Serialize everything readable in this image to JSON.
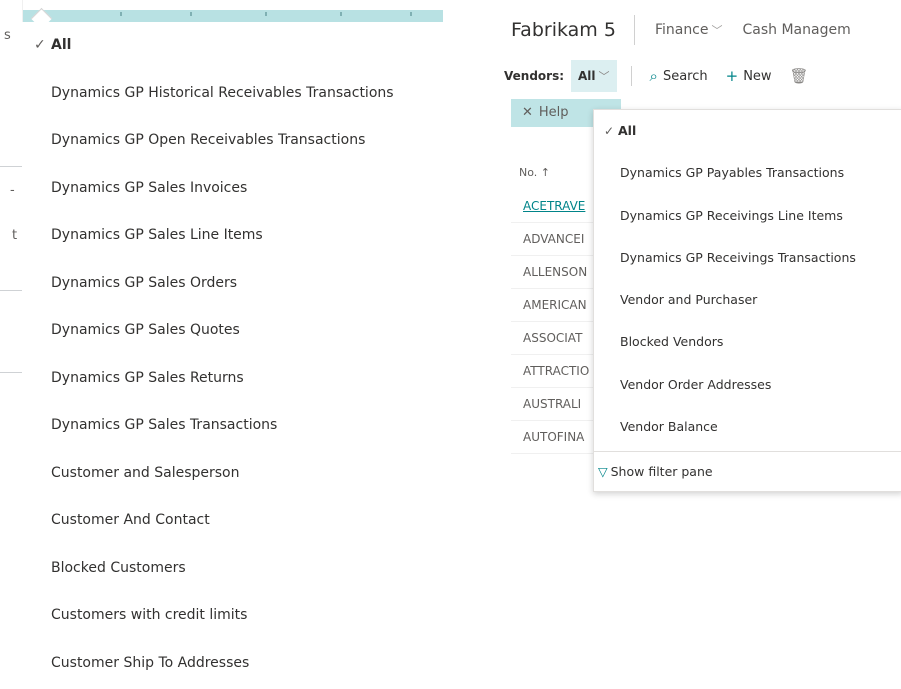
{
  "left_menu": {
    "all_label": "All",
    "items": [
      "Dynamics GP Historical Receivables Transactions",
      "Dynamics GP Open Receivables Transactions",
      "Dynamics GP Sales Invoices",
      "Dynamics GP Sales Line Items",
      "Dynamics GP Sales Orders",
      "Dynamics GP Sales Quotes",
      "Dynamics GP Sales Returns",
      "Dynamics GP Sales Transactions",
      "Customer and Salesperson",
      "Customer And Contact",
      "Blocked Customers",
      "Customers with credit limits",
      "Customer Ship To Addresses"
    ]
  },
  "right": {
    "company": "Fabrikam 5",
    "nav": [
      "Finance",
      "Cash Managem"
    ],
    "vendors_label": "Vendors:",
    "view_value": "All",
    "search_label": "Search",
    "new_label": "New",
    "help_label": "Help",
    "grid_header": "No. ↑",
    "grid_rows": [
      "ACETRAVE",
      "ADVANCEI",
      "ALLENSON",
      "AMERICAN",
      "ASSOCIAT",
      "ATTRACTIO",
      "AUSTRALI",
      "AUTOFINA"
    ],
    "dropdown": {
      "all_label": "All",
      "items": [
        "Dynamics GP Payables Transactions",
        "Dynamics GP Receivings Line Items",
        "Dynamics GP Receivings Transactions",
        "Vendor and Purchaser",
        "Blocked Vendors",
        "Vendor Order Addresses",
        "Vendor Balance"
      ],
      "footer_label": "Show filter pane"
    }
  },
  "colors": {
    "accent": "#008489",
    "teal_bar": "#b8e1e3",
    "selected_bg": "#dceff1"
  }
}
